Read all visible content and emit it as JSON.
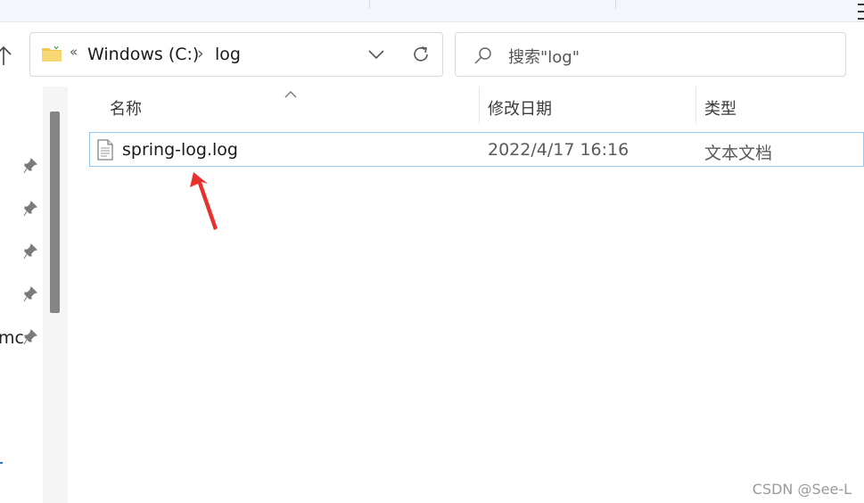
{
  "address": {
    "overflow_chevron": "«",
    "crumbs": [
      "Windows (C:)",
      "log"
    ],
    "separator": "›"
  },
  "search": {
    "placeholder": "搜索\"log\""
  },
  "nav": {
    "partial_item_text": "mc"
  },
  "columns": {
    "name": "名称",
    "modified": "修改日期",
    "type": "类型"
  },
  "files": [
    {
      "name": "spring-log.log",
      "modified": "2022/4/17 16:16",
      "type": "文本文档"
    }
  ],
  "colors": {
    "annotation_arrow": "#e8312f",
    "selection_border": "#99c9ef",
    "folder_yellow": "#f8d775"
  },
  "watermark": "CSDN @See-L"
}
